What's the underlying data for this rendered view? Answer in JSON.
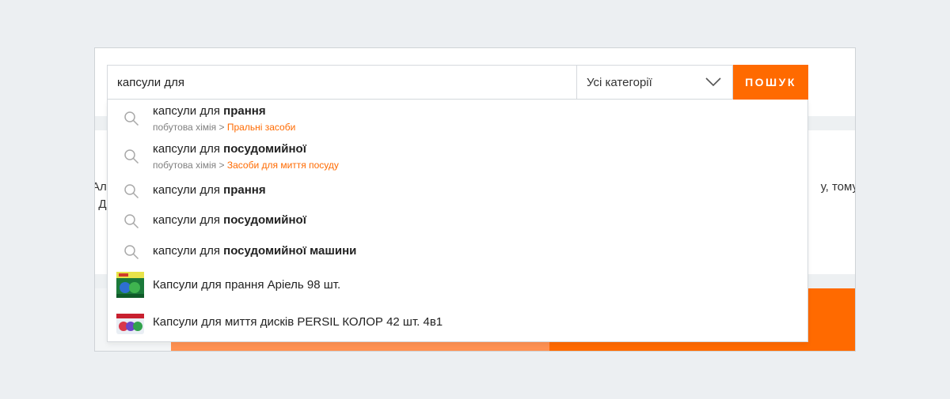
{
  "background": {
    "left_text_1": "Ал",
    "left_text_2": ". Д",
    "right_text": "у, тому"
  },
  "search": {
    "query": "капсули для",
    "category_label": "Усі категорії",
    "button_label": "ПОШУК"
  },
  "suggestions": [
    {
      "prefix": "капсули для",
      "bold": "прання",
      "path_parent": "побутова хімія",
      "path_sep": ">",
      "path_category": "Пральні засоби"
    },
    {
      "prefix": "капсули для",
      "bold": "посудомийної",
      "path_parent": "побутова хімія",
      "path_sep": ">",
      "path_category": "Засоби для миття посуду"
    },
    {
      "prefix": "капсули для",
      "bold": "прання"
    },
    {
      "prefix": "капсули для",
      "bold": "посудомийної"
    },
    {
      "prefix": "капсули для",
      "bold": "посудомийної машини"
    }
  ],
  "products": [
    {
      "name": "Капсули для прання Аріель 98 шт.",
      "thumb_icon": "ariel-product-thumbnail"
    },
    {
      "name": "Капсули для миття дисків PERSIL КОЛОР 42 шт. 4в1",
      "thumb_icon": "persil-product-thumbnail"
    }
  ],
  "colors": {
    "accent": "#ff6a00",
    "category_link": "#ff6a00"
  }
}
